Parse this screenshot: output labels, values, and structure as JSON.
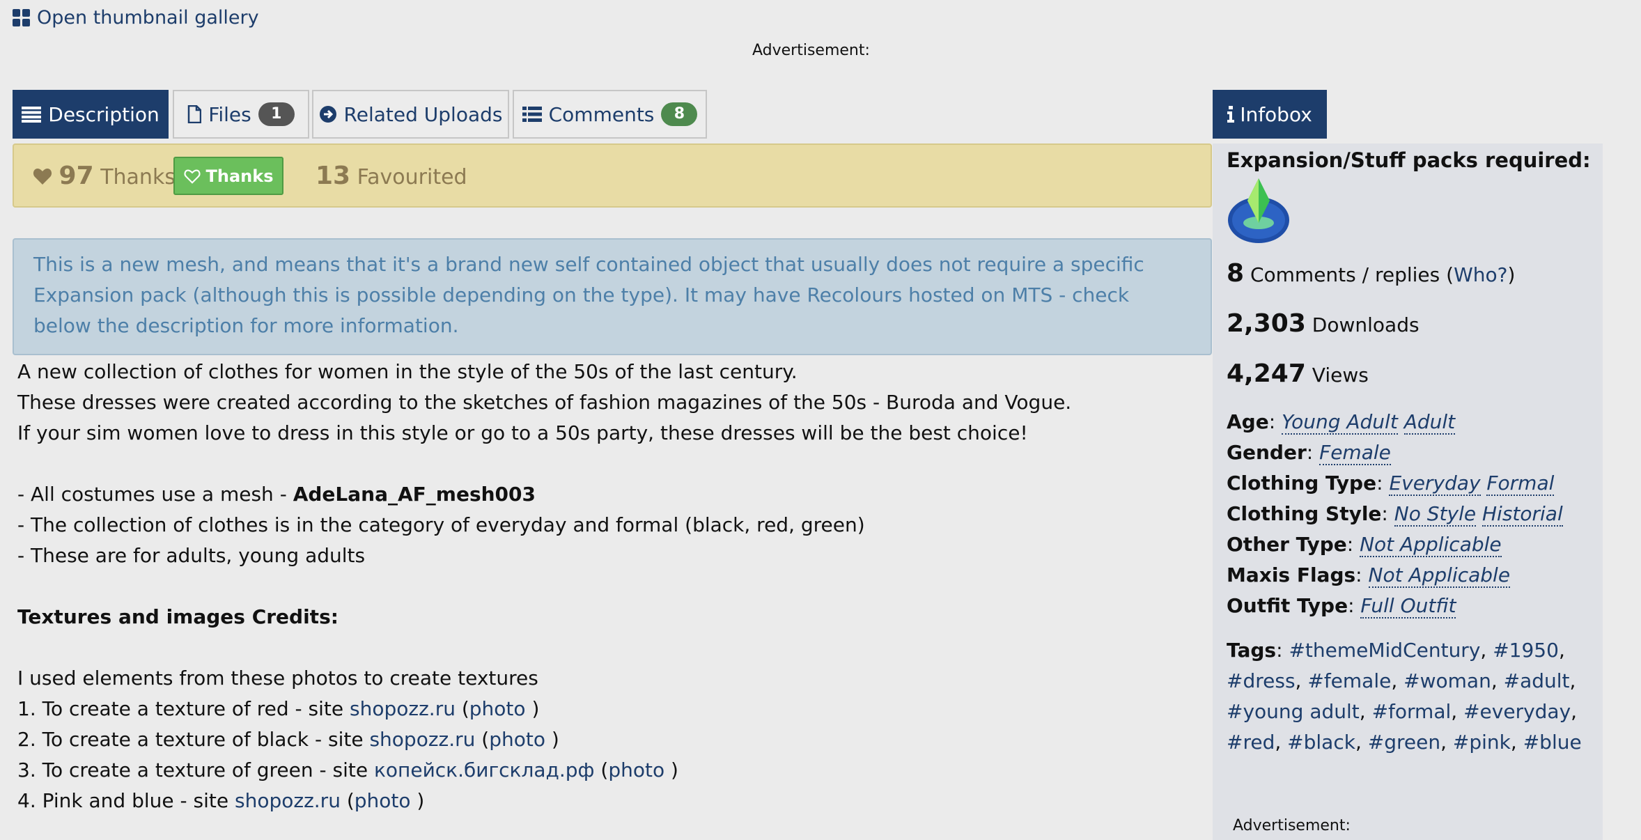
{
  "gallery_link": "Open thumbnail gallery",
  "ad_label": "Advertisement:",
  "tabs": {
    "description": "Description",
    "files": "Files",
    "files_count": "1",
    "related": "Related Uploads",
    "comments": "Comments",
    "comments_count": "8",
    "infobox": "Infobox"
  },
  "thanks_bar": {
    "thanks_count": "97",
    "thanks_label": "Thanks",
    "thanks_button": "Thanks",
    "favourited_count": "13",
    "favourited_label": "Favourited"
  },
  "notice": "This is a new mesh, and means that it's a brand new self contained object that usually does not require a specific Expansion pack (although this is possible depending on the type). It may have Recolours hosted on MTS - check below the description for more information.",
  "description": {
    "p1": "A new collection of clothes for women in the style of the 50s of the last century.",
    "p2": "These dresses were created according to the sketches of fashion magazines of the 50s - Buroda and Vogue.",
    "p3": "If your sim women love to dress in this style or go to a 50s party, these dresses will be the best choice!",
    "b1_prefix": "- All costumes use a mesh - ",
    "b1_mesh": "AdeLana_AF_mesh003",
    "b2": "- The collection of clothes is in the category of everyday and formal (black, red, green)",
    "b3": "- These are for adults, young adults",
    "credits_heading": "Textures and images Credits:",
    "credits_intro": "I used elements from these photos to create textures",
    "credits": [
      {
        "prefix": "1. To create a texture of red - site ",
        "site": "shopozz.ru",
        "photo": "photo"
      },
      {
        "prefix": "2. To create a texture of black - site ",
        "site": "shopozz.ru",
        "photo": "photo"
      },
      {
        "prefix": "3. To create a texture of green - site ",
        "site": "копейск.бигсклад.рф",
        "photo": "photo"
      },
      {
        "prefix": "4. Pink and blue - site ",
        "site": "shopozz.ru",
        "photo": "photo"
      }
    ]
  },
  "infobox": {
    "packs_label": "Expansion/Stuff packs required:",
    "comments_count": "8",
    "comments_label": "Comments / replies",
    "who_link": "Who?",
    "downloads_count": "2,303",
    "downloads_label": "Downloads",
    "views_count": "4,247",
    "views_label": "Views",
    "fields": [
      {
        "key": "Age",
        "values": [
          "Young Adult",
          "Adult"
        ]
      },
      {
        "key": "Gender",
        "values": [
          "Female"
        ]
      },
      {
        "key": "Clothing Type",
        "values": [
          "Everyday",
          "Formal"
        ]
      },
      {
        "key": "Clothing Style",
        "values": [
          "No Style",
          "Historial"
        ]
      },
      {
        "key": "Other Type",
        "values": [
          "Not Applicable"
        ]
      },
      {
        "key": "Maxis Flags",
        "values": [
          "Not Applicable"
        ]
      },
      {
        "key": "Outfit Type",
        "values": [
          "Full Outfit"
        ]
      }
    ],
    "tags_label": "Tags",
    "tags": [
      "#themeMidCentury",
      "#1950",
      "#dress",
      "#female",
      "#woman",
      "#adult",
      "#young adult",
      "#formal",
      "#everyday",
      "#red",
      "#black",
      "#green",
      "#pink",
      "#blue"
    ]
  },
  "colors": {
    "primary": "#1d3d6b",
    "thanks_bar": "#e8dca5",
    "thanks_button": "#6bbf5c",
    "notice_bg": "#c3d3de",
    "notice_text": "#4d7fa8",
    "badge_grey": "#555555",
    "badge_green": "#4e8a4e"
  }
}
